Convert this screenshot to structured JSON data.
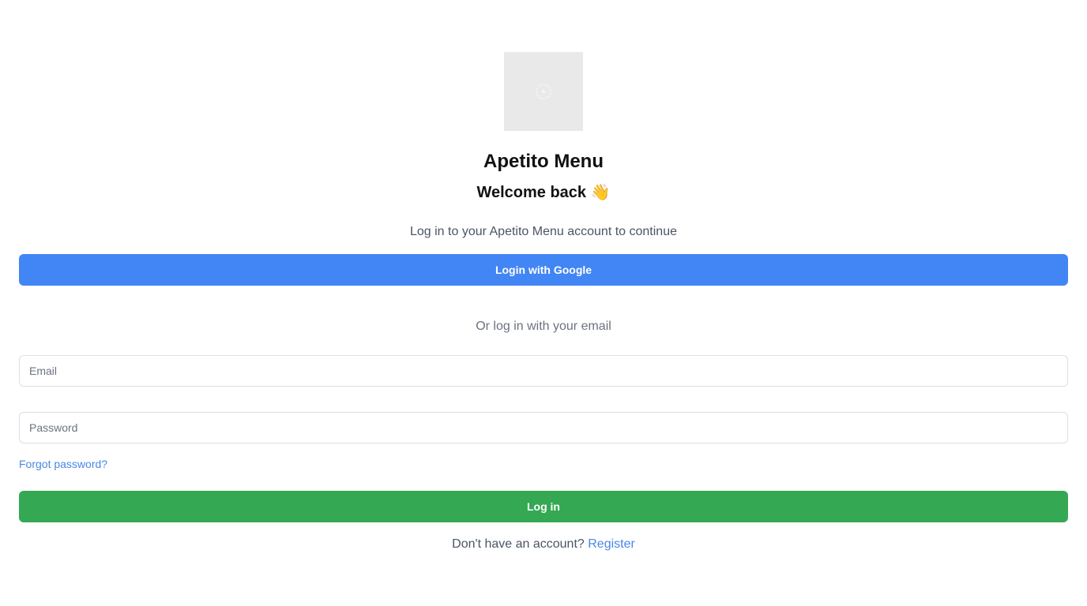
{
  "app": {
    "title": "Apetito Menu",
    "welcome": "Welcome back 👋",
    "subtitle": "Log in to your Apetito Menu account to continue"
  },
  "google_button": {
    "label": "Login with Google",
    "color": "#4285f4"
  },
  "divider": {
    "text": "Or log in with your email"
  },
  "form": {
    "email": {
      "placeholder": "Email",
      "value": ""
    },
    "password": {
      "placeholder": "Password",
      "value": ""
    },
    "forgot_label": "Forgot password?",
    "submit_label": "Log in",
    "submit_color": "#34a853"
  },
  "footer": {
    "prompt": "Don't have an account?",
    "register_label": "Register",
    "link_color": "#4a86e8"
  },
  "icons": {
    "logo": "loading-spinner-icon"
  }
}
